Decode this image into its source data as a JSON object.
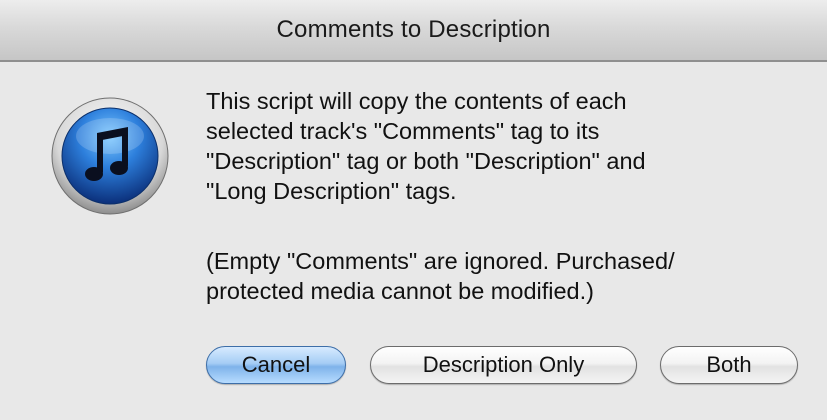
{
  "dialog": {
    "title": "Comments to Description",
    "icon": "itunes-music-note-icon",
    "message": "This script will copy the contents of each\nselected track's \"Comments\" tag to its\n\"Description\" tag or both \"Description\" and\n\"Long Description\" tags.",
    "note": "(Empty \"Comments\" are ignored. Purchased/\nprotected media cannot be modified.)"
  },
  "buttons": {
    "cancel_label": "Cancel",
    "description_only_label": "Description Only",
    "both_label": "Both"
  },
  "colors": {
    "default_button": "#a6cdf5",
    "icon_blue": "#1f5fb6"
  }
}
